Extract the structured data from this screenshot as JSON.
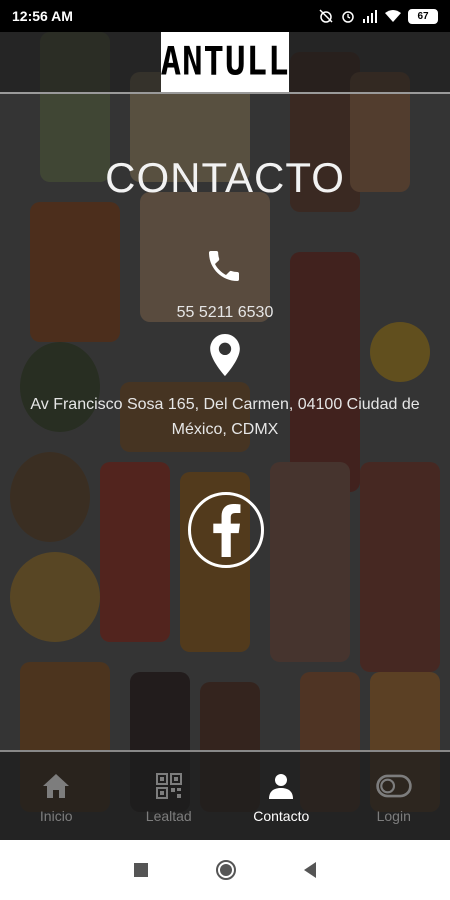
{
  "status_bar": {
    "time": "12:56 AM",
    "battery": "67",
    "icons": [
      "alarm-off-icon",
      "alarm-icon",
      "signal-icon",
      "wifi-icon",
      "battery-icon"
    ]
  },
  "header": {
    "logo_text": "ANTULL"
  },
  "page": {
    "title": "CONTACTO",
    "phone": "55 5211 6530",
    "address": "Av Francisco Sosa 165, Del Carmen, 04100 Ciudad de México, CDMX",
    "icons": [
      "phone-icon",
      "location-pin-icon",
      "facebook-icon"
    ]
  },
  "tabbar": {
    "tabs": [
      {
        "label": "Inicio",
        "icon": "home-icon"
      },
      {
        "label": "Lealtad",
        "icon": "qr-code-icon"
      },
      {
        "label": "Contacto",
        "icon": "user-icon"
      },
      {
        "label": "Login",
        "icon": "toggle-icon"
      }
    ],
    "active_tab": "Contacto"
  },
  "navbar": {
    "icons": [
      "recents-icon",
      "home-icon",
      "back-icon"
    ]
  },
  "colors": {
    "text": "#ffffff",
    "inactive_tab": "#7d7d7d",
    "overlay": "#141414"
  }
}
